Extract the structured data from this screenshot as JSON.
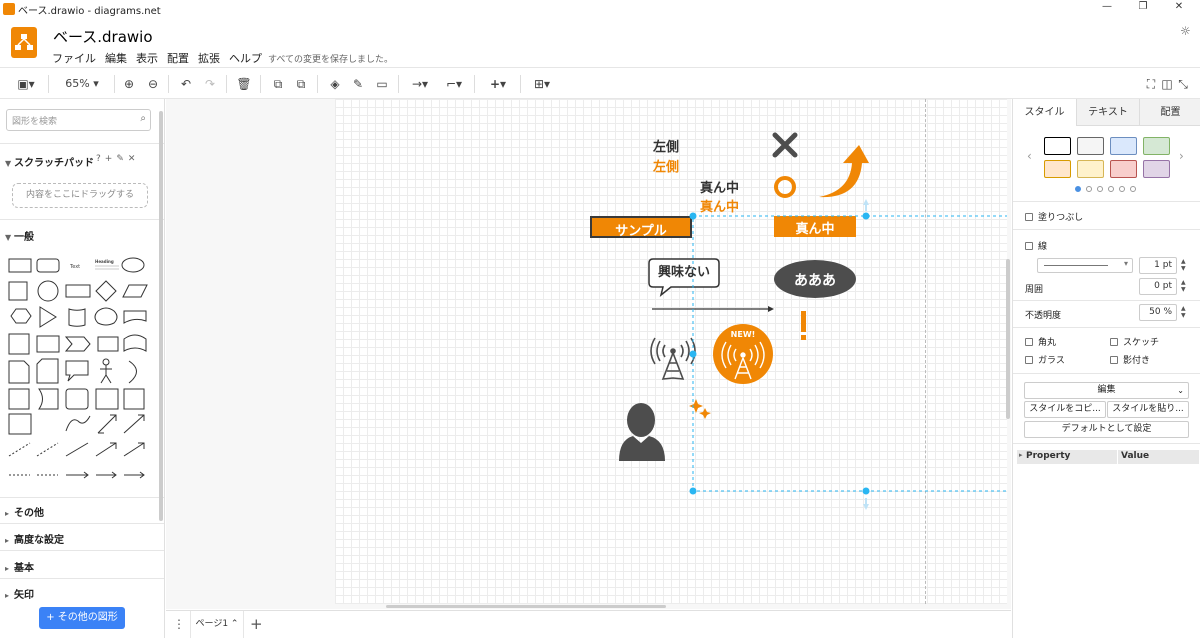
{
  "window": {
    "title": "ベース.drawio - diagrams.net",
    "controls": [
      "—",
      "❐",
      "✕"
    ]
  },
  "header": {
    "doc_title": "ベース.drawio",
    "menu": [
      "ファイル",
      "編集",
      "表示",
      "配置",
      "拡張",
      "ヘルプ"
    ],
    "save_status": "すべての変更を保存しました。"
  },
  "toolbar": {
    "zoom": "65%"
  },
  "sidebar": {
    "search_placeholder": "図形を検索",
    "scratchpad_title": "スクラッチパッド",
    "scratchpad_help": "?",
    "dropzone_text": "内容をここにドラッグする",
    "general_title": "一般",
    "sections": [
      "その他",
      "高度な設定",
      "基本",
      "矢印"
    ],
    "more_shapes": "+ その他の図形",
    "shape_labels": {
      "text": "Text",
      "heading": "Heading"
    }
  },
  "canvas": {
    "texts": {
      "left_dark": "左側",
      "left_orange": "左側",
      "center_dark": "真ん中",
      "center_orange": "真ん中",
      "sample_box": "サンプル",
      "center_box": "真ん中",
      "callout": "興味ない",
      "ellipse": "あああ",
      "new_badge": "NEW!",
      "exclamation": "!"
    },
    "colors": {
      "orange": "#f08705",
      "dark": "#4d4d4d",
      "selection": "#29b6f2"
    }
  },
  "pagetabs": {
    "current": "ページ1",
    "menu_icon": "⋮",
    "add": "+"
  },
  "format_panel": {
    "tabs": [
      "スタイル",
      "テキスト",
      "配置"
    ],
    "swatches": [
      {
        "fill": "#ffffff",
        "stroke": "#000000"
      },
      {
        "fill": "#f5f5f5",
        "stroke": "#666666"
      },
      {
        "fill": "#dae8fc",
        "stroke": "#6c8ebf"
      },
      {
        "fill": "#d5e8d4",
        "stroke": "#82b366"
      },
      {
        "fill": "#ffe6cc",
        "stroke": "#d79b00"
      },
      {
        "fill": "#fff2cc",
        "stroke": "#d6b656"
      },
      {
        "fill": "#f8cecc",
        "stroke": "#b85450"
      },
      {
        "fill": "#e1d5e7",
        "stroke": "#9673a6"
      }
    ],
    "fill_label": "塗りつぶし",
    "line_label": "線",
    "line_width": "1 pt",
    "perimeter_label": "周囲",
    "perimeter_value": "0 pt",
    "opacity_label": "不透明度",
    "opacity_value": "50 %",
    "rounded_label": "角丸",
    "sketch_label": "スケッチ",
    "glass_label": "ガラス",
    "shadow_label": "影付き",
    "edit_button": "編集",
    "copy_style": "スタイルをコピ...",
    "paste_style": "スタイルを貼り...",
    "set_default": "デフォルトとして設定",
    "property_header": "Property",
    "value_header": "Value"
  }
}
